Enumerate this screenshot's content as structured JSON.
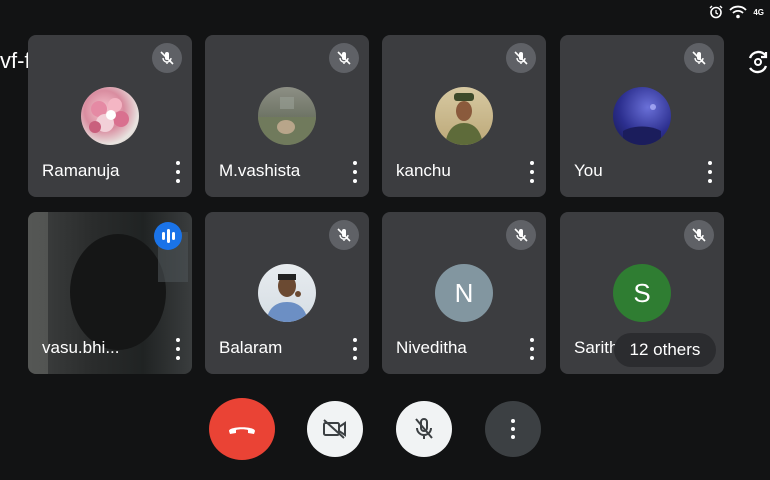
{
  "status_bar": {
    "network": "4G"
  },
  "meeting": {
    "code": "vf-fpza-wxs"
  },
  "participants": [
    {
      "name": "Ramanuja"
    },
    {
      "name": "M.vashista"
    },
    {
      "name": "kanchu"
    },
    {
      "name": "You"
    },
    {
      "name": "vasu.bhi..."
    },
    {
      "name": "Balaram"
    },
    {
      "name": "Niveditha",
      "initial": "N"
    },
    {
      "name": "Sarith",
      "initial": "S"
    }
  ],
  "others_label": "12 others",
  "colors": {
    "tile_bg": "#3c3d40",
    "end_call": "#ea4335",
    "speaking": "#1a73e8",
    "avatar_n": "#8296a0",
    "avatar_s": "#2f7d32"
  },
  "icons": [
    "alarm-icon",
    "wifi-icon",
    "mic-off-icon",
    "more-vert-icon",
    "speaking-icon",
    "rotate-camera-icon",
    "end-call-icon",
    "camera-off-icon",
    "mic-off-icon",
    "more-vert-icon"
  ]
}
